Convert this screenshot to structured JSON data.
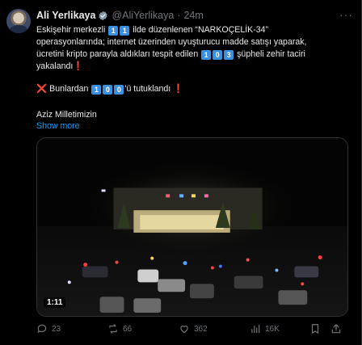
{
  "author": {
    "display_name": "Ali Yerlikaya",
    "handle": "@AliYerlikaya",
    "separator": "·",
    "time": "24m"
  },
  "tweet": {
    "line1_a": "Eskişehir merkezli",
    "key_11a": "1",
    "key_11b": "1",
    "line1_b": "ilde  düzenlenen “NARKOÇELİK-34”",
    "line2": "operasyonlarında; internet üzerinden uyuşturucu madde satışı yaparak,",
    "line3_a": "ücretini kripto parayla aldıkları tespit edilen",
    "key_103a": "1",
    "key_103b": "0",
    "key_103c": "3",
    "line3_b": "şüpheli zehir taciri",
    "line4_a": "yakalandı",
    "line4_mark": "❗",
    "arrest_cross": "❌",
    "arrest_a": "Bunlardan",
    "key_100a": "1",
    "key_100b": "0",
    "key_100c": "0",
    "arrest_b": "'ü tutuklandı",
    "arrest_mark": "❗",
    "signature": "Aziz Milletimizin",
    "show_more": "Show more"
  },
  "media": {
    "duration": "1:11"
  },
  "actions": {
    "replies": "23",
    "reposts": "66",
    "likes": "362",
    "views": "16K"
  },
  "colors": {
    "background": "#000000",
    "text": "#e7e9ea",
    "secondary": "#71767b",
    "link": "#1d9bf0",
    "keycap": "#3b8fe0",
    "alert_red": "#f4212e"
  },
  "icons": [
    "verified-badge-icon",
    "more-icon",
    "reply-icon",
    "repost-icon",
    "like-icon",
    "views-icon",
    "bookmark-icon",
    "share-icon"
  ]
}
